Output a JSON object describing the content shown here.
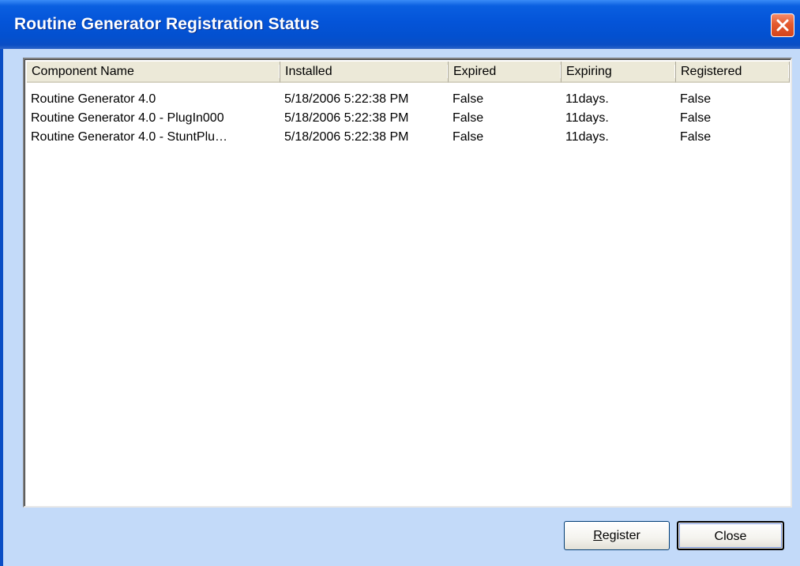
{
  "window": {
    "title": "Routine Generator Registration Status"
  },
  "listview": {
    "columns": [
      "Component Name",
      "Installed",
      "Expired",
      "Expiring",
      "Registered"
    ],
    "rows": [
      [
        "Routine Generator 4.0",
        "5/18/2006 5:22:38 PM",
        "False",
        "11days.",
        "False"
      ],
      [
        "Routine Generator 4.0 - PlugIn000",
        "5/18/2006 5:22:38 PM",
        "False",
        "11days.",
        "False"
      ],
      [
        "Routine Generator 4.0 - StuntPlu…",
        "5/18/2006 5:22:38 PM",
        "False",
        "11days.",
        "False"
      ]
    ]
  },
  "buttons": {
    "register_mnemonic": "R",
    "register_rest": "egister",
    "close": "Close"
  },
  "icons": {
    "close": "close-icon"
  },
  "colors": {
    "titlebar": "#0454d8",
    "dialog_bg": "#c3daf9",
    "close_button": "#e45a2e"
  }
}
